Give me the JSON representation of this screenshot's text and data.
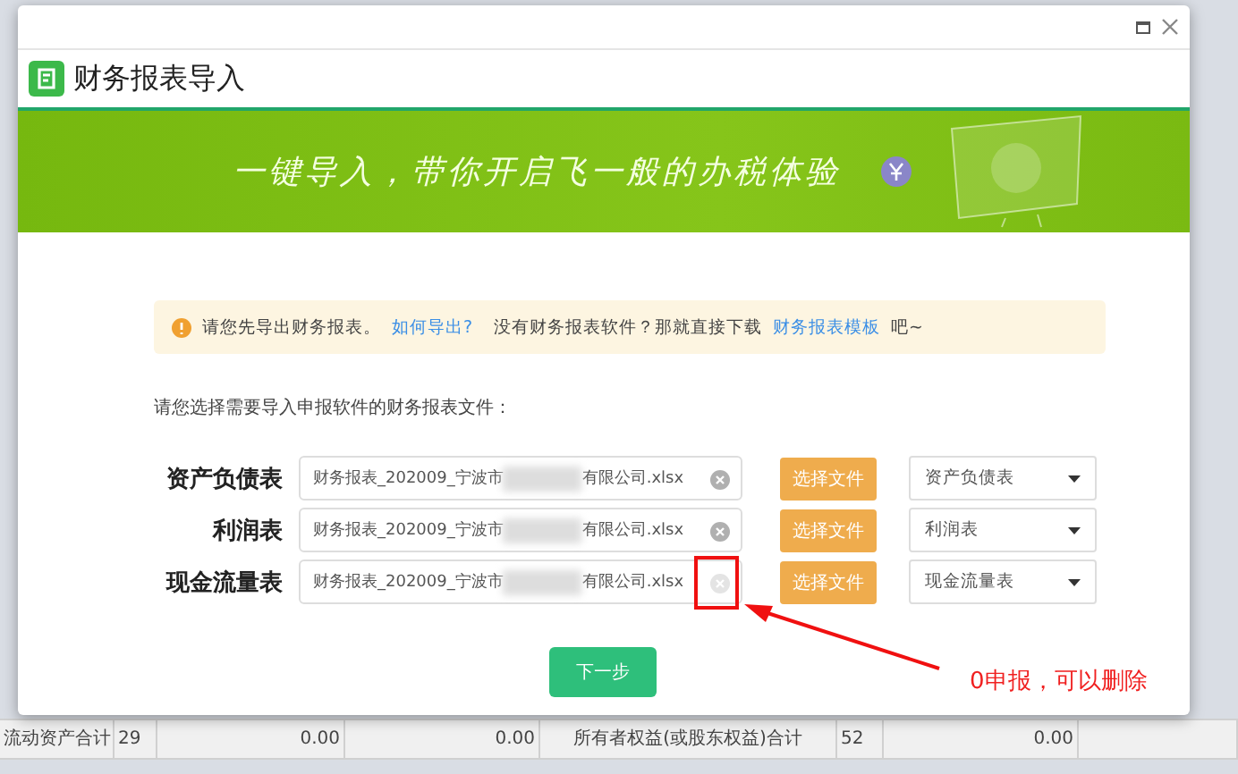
{
  "background_table": {
    "row": [
      "流动资产合计",
      "29",
      "0.00",
      "0.00",
      "所有者权益(或股东权益)合计",
      "52",
      "0.00"
    ]
  },
  "dialog": {
    "title": "财务报表导入",
    "banner_slogan": "一键导入，带你开启飞一般的办税体验",
    "notice": {
      "text": "请您先导出财务报表。",
      "link": "如何导出?",
      "text2": "没有财务报表软件？那就直接下载",
      "link2": "财务报表模板",
      "text3": "吧~"
    },
    "instruction": "请您选择需要导入申报软件的财务报表文件：",
    "rows": [
      {
        "label": "资产负债表",
        "file_prefix": "财务报表_202009_宁波市",
        "file_suffix": "有限公司.xlsx",
        "button": "选择文件",
        "select": "资产负债表",
        "highlighted": false
      },
      {
        "label": "利润表",
        "file_prefix": "财务报表_202009_宁波市",
        "file_suffix": "有限公司.xlsx",
        "button": "选择文件",
        "select": "利润表",
        "highlighted": false
      },
      {
        "label": "现金流量表",
        "file_prefix": "财务报表_202009_宁波市",
        "file_suffix": "有限公司.xlsx",
        "button": "选择文件",
        "select": "现金流量表",
        "highlighted": true
      }
    ],
    "next_button": "下一步"
  },
  "annotation": {
    "text": "0申报，可以删除"
  }
}
